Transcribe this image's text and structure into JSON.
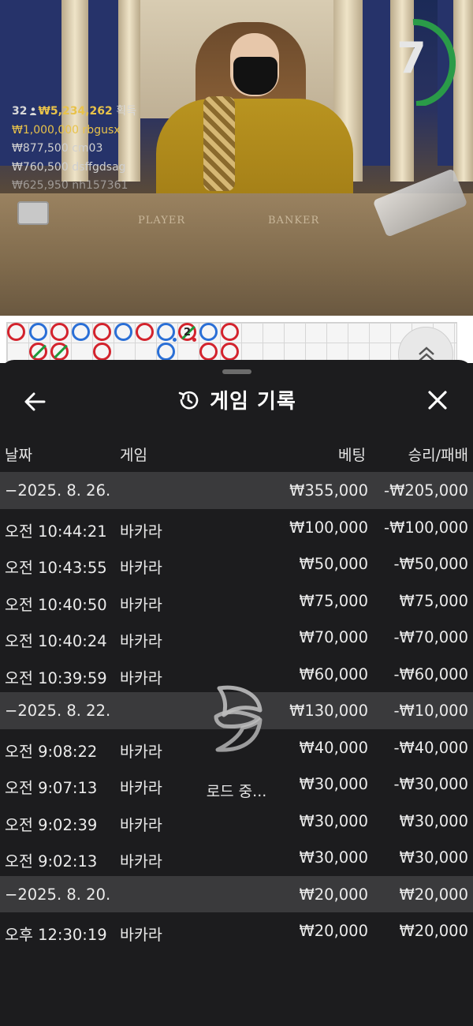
{
  "stream": {
    "timer": "7",
    "player_count": "32",
    "total_won": "₩5,234,262",
    "won_suffix": "획득",
    "table_labels": [
      "PLAYER",
      "BANKER"
    ],
    "winners": [
      {
        "amount": "₩1,000,000",
        "user": "rbgusx"
      },
      {
        "amount": "₩877,500",
        "user": "cm03"
      },
      {
        "amount": "₩760,500",
        "user": "dsffgdsag"
      },
      {
        "amount": "₩625,950",
        "user": "nh157361"
      }
    ]
  },
  "roadmap": {
    "badge": "2",
    "colors": {
      "banker": "#d3232d",
      "player": "#2a6fd6",
      "tie": "#1e9b3c"
    }
  },
  "sheet": {
    "title": "게임 기록",
    "columns": {
      "date": "날짜",
      "game": "게임",
      "bet": "베팅",
      "win": "승리/패배"
    },
    "rows": [
      {
        "type": "group",
        "date": "−2025. 8. 26.",
        "game": "",
        "bet": "₩355,000",
        "win": "-₩205,000"
      },
      {
        "type": "item",
        "date": "오전 10:44:21",
        "game": "바카라",
        "bet": "₩100,000",
        "win": "-₩100,000"
      },
      {
        "type": "item",
        "date": "오전 10:43:55",
        "game": "바카라",
        "bet": "₩50,000",
        "win": "-₩50,000"
      },
      {
        "type": "item",
        "date": "오전 10:40:50",
        "game": "바카라",
        "bet": "₩75,000",
        "win": "₩75,000"
      },
      {
        "type": "item",
        "date": "오전 10:40:24",
        "game": "바카라",
        "bet": "₩70,000",
        "win": "-₩70,000"
      },
      {
        "type": "item",
        "date": "오전 10:39:59",
        "game": "바카라",
        "bet": "₩60,000",
        "win": "-₩60,000"
      },
      {
        "type": "group",
        "date": "−2025. 8. 22.",
        "game": "",
        "bet": "₩130,000",
        "win": "-₩10,000"
      },
      {
        "type": "item",
        "date": "오전 9:08:22",
        "game": "바카라",
        "bet": "₩40,000",
        "win": "-₩40,000"
      },
      {
        "type": "item",
        "date": "오전 9:07:13",
        "game": "바카라",
        "bet": "₩30,000",
        "win": "-₩30,000"
      },
      {
        "type": "item",
        "date": "오전 9:02:39",
        "game": "바카라",
        "bet": "₩30,000",
        "win": "₩30,000"
      },
      {
        "type": "item",
        "date": "오전 9:02:13",
        "game": "바카라",
        "bet": "₩30,000",
        "win": "₩30,000"
      },
      {
        "type": "group",
        "date": "−2025. 8. 20.",
        "game": "",
        "bet": "₩20,000",
        "win": "₩20,000"
      },
      {
        "type": "item",
        "date": "오후 12:30:19",
        "game": "바카라",
        "bet": "₩20,000",
        "win": "₩20,000"
      }
    ],
    "loading_text": "로드 중..."
  },
  "icons": {
    "back": "arrow-left-icon",
    "close": "close-icon",
    "history": "history-clock-icon",
    "expand": "chevron-up-double-icon",
    "loader": "spinner-icon",
    "player": "person-icon"
  }
}
